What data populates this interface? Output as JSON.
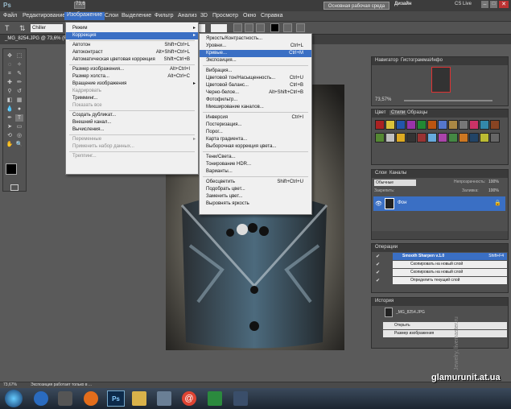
{
  "titlebar": {
    "app_logo": "Ps",
    "zoom": "73,6",
    "workspace_button": "Основная рабочая среда",
    "design_label": "Дизайн",
    "cs_live": "CS Live"
  },
  "menubar": [
    "Файл",
    "Редактирование",
    "Изображение",
    "Слои",
    "Выделение",
    "Фильтр",
    "Анализ",
    "3D",
    "Просмотр",
    "Окно",
    "Справка"
  ],
  "options": {
    "font": "Chiller"
  },
  "document_tab": "_MG_8254.JPG @ 73,6% (RG",
  "image_menu": {
    "items": [
      {
        "label": "Режим",
        "shortcut": "",
        "arrow": true,
        "disabled": false
      },
      {
        "label": "Коррекция",
        "shortcut": "",
        "arrow": true,
        "disabled": false,
        "highlight": true
      },
      {
        "label": "Автотон",
        "shortcut": "Shift+Ctrl+L",
        "disabled": false
      },
      {
        "label": "Автоконтраст",
        "shortcut": "Alt+Shift+Ctrl+L",
        "disabled": false
      },
      {
        "label": "Автоматическая цветовая коррекция",
        "shortcut": "Shift+Ctrl+B",
        "disabled": false
      },
      {
        "label": "Размер изображения...",
        "shortcut": "Alt+Ctrl+I",
        "disabled": false
      },
      {
        "label": "Размер холста...",
        "shortcut": "Alt+Ctrl+C",
        "disabled": false
      },
      {
        "label": "Вращение изображения",
        "shortcut": "",
        "arrow": true,
        "disabled": false
      },
      {
        "label": "Кадрировать",
        "shortcut": "",
        "disabled": true
      },
      {
        "label": "Тримминг...",
        "shortcut": "",
        "disabled": false
      },
      {
        "label": "Показать все",
        "shortcut": "",
        "disabled": true
      },
      {
        "label": "Создать дубликат...",
        "shortcut": "",
        "disabled": false
      },
      {
        "label": "Внешний канал...",
        "shortcut": "",
        "disabled": false
      },
      {
        "label": "Вычисления...",
        "shortcut": "",
        "disabled": false
      },
      {
        "label": "Переменные",
        "shortcut": "",
        "arrow": true,
        "disabled": true
      },
      {
        "label": "Применить набор данных...",
        "shortcut": "",
        "disabled": true
      },
      {
        "label": "Треппинг...",
        "shortcut": "",
        "disabled": true
      }
    ]
  },
  "corrections_menu": {
    "items": [
      {
        "label": "Яркость/Контрастность...",
        "shortcut": ""
      },
      {
        "label": "Уровни...",
        "shortcut": "Ctrl+L"
      },
      {
        "label": "Кривые...",
        "shortcut": "Ctrl+M",
        "highlight": true
      },
      {
        "label": "Экспозиция...",
        "shortcut": ""
      },
      {
        "label": "Вибрация...",
        "shortcut": ""
      },
      {
        "label": "Цветовой тон/Насыщенность...",
        "shortcut": "Ctrl+U"
      },
      {
        "label": "Цветовой баланс...",
        "shortcut": "Ctrl+B"
      },
      {
        "label": "Черно-белое...",
        "shortcut": "Alt+Shift+Ctrl+B"
      },
      {
        "label": "Фотофильтр...",
        "shortcut": ""
      },
      {
        "label": "Микширование каналов...",
        "shortcut": ""
      },
      {
        "label": "Инверсия",
        "shortcut": "Ctrl+I"
      },
      {
        "label": "Постеризация...",
        "shortcut": ""
      },
      {
        "label": "Порог...",
        "shortcut": ""
      },
      {
        "label": "Карта градиента...",
        "shortcut": ""
      },
      {
        "label": "Выборочная коррекция цвета...",
        "shortcut": ""
      },
      {
        "label": "Тени/Света...",
        "shortcut": ""
      },
      {
        "label": "Тонирование HDR...",
        "shortcut": ""
      },
      {
        "label": "Варианты...",
        "shortcut": ""
      },
      {
        "label": "Обесцветить",
        "shortcut": "Shift+Ctrl+U"
      },
      {
        "label": "Подобрать цвет...",
        "shortcut": ""
      },
      {
        "label": "Заменить цвет...",
        "shortcut": ""
      },
      {
        "label": "Выровнять яркость",
        "shortcut": ""
      }
    ]
  },
  "navigator": {
    "tabs": [
      "Навигатор",
      "Гистограмма",
      "Инфо"
    ],
    "zoom": "73,57%"
  },
  "swatches": {
    "tabs": [
      "Цвет",
      "Стили",
      "Образцы"
    ]
  },
  "layers": {
    "tabs": [
      "Слои",
      "Каналы"
    ],
    "blend": "Обычные",
    "opacity_label": "Непрозрачность:",
    "opacity": "100%",
    "fill_label": "Заливка:",
    "fill": "100%",
    "lock_label": "Закрепить:",
    "layer_name": "Фон"
  },
  "actions": {
    "tab": "Операции",
    "items": [
      {
        "label": "Smooth Sharpen v.1.0",
        "shortcut": "Shift+F4"
      },
      {
        "label": "Скопировать на новый слой"
      },
      {
        "label": "Скопировать на новый слой"
      },
      {
        "label": "Определить текущий слой"
      }
    ]
  },
  "history": {
    "tab": "История",
    "items": [
      "_MG_8254.JPG",
      "Открыть",
      "Размер изображения"
    ]
  },
  "status": {
    "zoom": "73,67%",
    "text": "Экспозиция работает только в ..."
  },
  "watermark": {
    "site": "glamurunit.at.ua",
    "side": "Jewelry, livemaster.ru"
  }
}
